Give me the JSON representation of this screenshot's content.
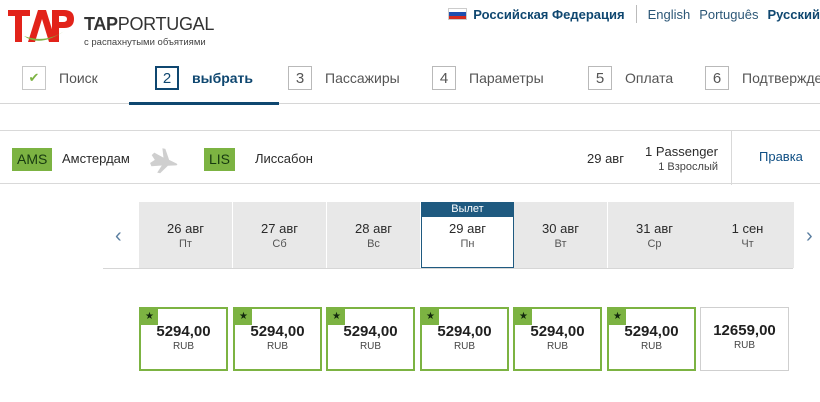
{
  "header": {
    "logo_brand": "TAP",
    "logo_name_bold": "TAP",
    "logo_name_rest": "PORTUGAL",
    "logo_tagline": "с распахнутыми объятиями",
    "country": "Российская Федерация",
    "languages": [
      "English",
      "Português",
      "Русский"
    ],
    "active_language": "Русский"
  },
  "steps": [
    {
      "number": "✔",
      "label": "Поиск",
      "state": "done"
    },
    {
      "number": "2",
      "label": "выбрать",
      "state": "active"
    },
    {
      "number": "3",
      "label": "Пассажиры",
      "state": "upcoming"
    },
    {
      "number": "4",
      "label": "Параметры",
      "state": "upcoming"
    },
    {
      "number": "5",
      "label": "Оплата",
      "state": "upcoming"
    },
    {
      "number": "6",
      "label": "Подтверждение",
      "state": "upcoming"
    }
  ],
  "route": {
    "origin_code": "AMS",
    "origin_city": "Амстердам",
    "destination_code": "LIS",
    "destination_city": "Лиссабон",
    "date": "29 авг",
    "passengers": "1 Passenger",
    "passenger_detail": "1 Взрослый",
    "edit_label": "Правка"
  },
  "dates": [
    {
      "date": "26 авг",
      "day": "Пт"
    },
    {
      "date": "27 авг",
      "day": "Сб"
    },
    {
      "date": "28 авг",
      "day": "Вс"
    },
    {
      "date": "29 авг",
      "day": "Пн",
      "tag": "Вылет"
    },
    {
      "date": "30 авг",
      "day": "Вт"
    },
    {
      "date": "31 авг",
      "day": "Ср"
    },
    {
      "date": "1 сен",
      "day": "Чт"
    }
  ],
  "prices": [
    {
      "amount": "5294,00",
      "currency": "RUB",
      "best": true,
      "star": "★"
    },
    {
      "amount": "5294,00",
      "currency": "RUB",
      "best": true,
      "star": "★"
    },
    {
      "amount": "5294,00",
      "currency": "RUB",
      "best": true,
      "star": "★"
    },
    {
      "amount": "5294,00",
      "currency": "RUB",
      "best": true,
      "star": "★"
    },
    {
      "amount": "5294,00",
      "currency": "RUB",
      "best": true,
      "star": "★"
    },
    {
      "amount": "5294,00",
      "currency": "RUB",
      "best": true,
      "star": "★"
    },
    {
      "amount": "12659,00",
      "currency": "RUB",
      "best": false
    }
  ],
  "colors": {
    "brand_red": "#e2231a",
    "brand_green": "#7cb342",
    "navy": "#0f4770",
    "selected_date": "#1f5a80"
  },
  "icons": {
    "prev": "chevron-left-icon",
    "next": "chevron-right-icon",
    "plane": "plane-icon",
    "check": "checkmark-icon",
    "flag": "russia-flag-icon"
  }
}
